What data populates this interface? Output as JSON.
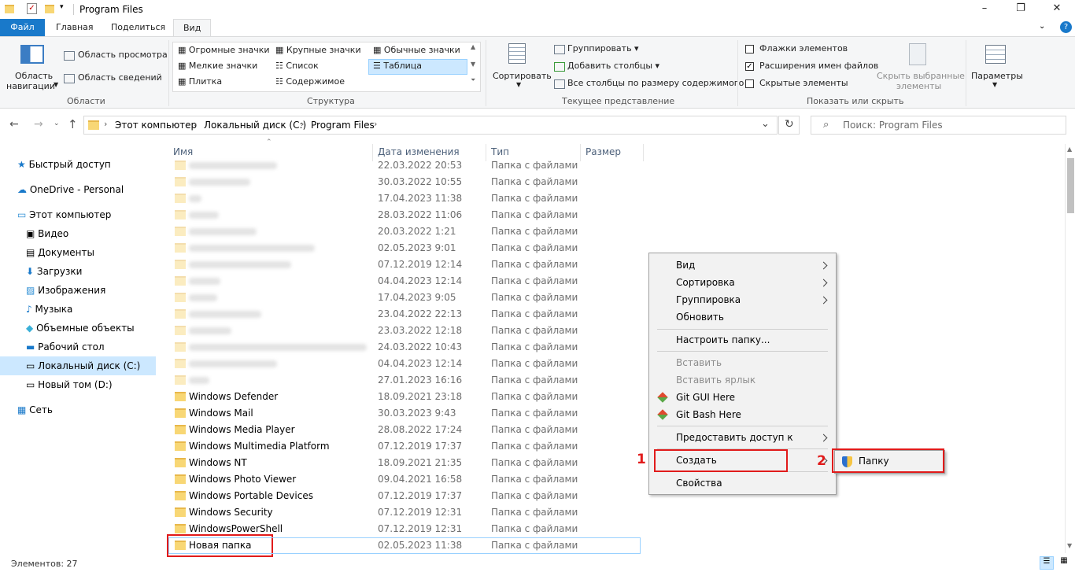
{
  "window": {
    "title": "Program Files"
  },
  "tabs": [
    "Файл",
    "Главная",
    "Поделиться",
    "Вид"
  ],
  "ribbon": {
    "panes": {
      "nav_label1": "Область",
      "nav_label2": "навигации",
      "preview": "Область просмотра",
      "details": "Область сведений",
      "title": "Области"
    },
    "layout": {
      "items": [
        "Огромные значки",
        "Крупные значки",
        "Обычные значки",
        "Мелкие значки",
        "Список",
        "Таблица",
        "Плитка",
        "Содержимое"
      ],
      "title": "Структура"
    },
    "current": {
      "sort": "Сортировать",
      "group": "Группировать",
      "add_cols": "Добавить столбцы",
      "fit_cols": "Все столбцы по размеру содержимого",
      "title": "Текущее представление"
    },
    "showhide": {
      "checkboxes": "Флажки элементов",
      "extensions": "Расширения имен файлов",
      "hidden": "Скрытые элементы",
      "hide_sel1": "Скрыть выбранные",
      "hide_sel2": "элементы",
      "title": "Показать или скрыть"
    },
    "options": "Параметры"
  },
  "address": {
    "crumbs": [
      "Этот компьютер",
      "Локальный диск (C:)",
      "Program Files"
    ],
    "search_placeholder": "Поиск: Program Files"
  },
  "nav": {
    "quick": "Быстрый доступ",
    "onedrive": "OneDrive - Personal",
    "pc": "Этот компьютер",
    "video": "Видео",
    "docs": "Документы",
    "downloads": "Загрузки",
    "images": "Изображения",
    "music": "Музыка",
    "objects3d": "Объемные объекты",
    "desktop": "Рабочий стол",
    "diskc": "Локальный диск (C:)",
    "diskd": "Новый том (D:)",
    "network": "Сеть"
  },
  "columns": {
    "name": "Имя",
    "date": "Дата изменения",
    "type": "Тип",
    "size": "Размер"
  },
  "rows": [
    {
      "date": "22.03.2022 20:53",
      "type": "Папка с файлами"
    },
    {
      "date": "30.03.2022 10:55",
      "type": "Папка с файлами"
    },
    {
      "date": "17.04.2023 11:38",
      "type": "Папка с файлами"
    },
    {
      "date": "28.03.2022 11:06",
      "type": "Папка с файлами"
    },
    {
      "date": "20.03.2022 1:21",
      "type": "Папка с файлами"
    },
    {
      "date": "02.05.2023 9:01",
      "type": "Папка с файлами"
    },
    {
      "date": "07.12.2019 12:14",
      "type": "Папка с файлами"
    },
    {
      "date": "04.04.2023 12:14",
      "type": "Папка с файлами"
    },
    {
      "date": "17.04.2023 9:05",
      "type": "Папка с файлами"
    },
    {
      "date": "23.04.2022 22:13",
      "type": "Папка с файлами"
    },
    {
      "date": "23.03.2022 12:18",
      "type": "Папка с файлами"
    },
    {
      "date": "24.03.2022 10:43",
      "type": "Папка с файлами"
    },
    {
      "date": "04.04.2023 12:14",
      "type": "Папка с файлами"
    },
    {
      "date": "27.01.2023 16:16",
      "type": "Папка с файлами"
    },
    {
      "name": "Windows Defender",
      "date": "18.09.2021 23:18",
      "type": "Папка с файлами"
    },
    {
      "name": "Windows Mail",
      "date": "30.03.2023 9:43",
      "type": "Папка с файлами"
    },
    {
      "name": "Windows Media Player",
      "date": "28.08.2022 17:24",
      "type": "Папка с файлами"
    },
    {
      "name": "Windows Multimedia Platform",
      "date": "07.12.2019 17:37",
      "type": "Папка с файлами"
    },
    {
      "name": "Windows NT",
      "date": "18.09.2021 21:35",
      "type": "Папка с файлами"
    },
    {
      "name": "Windows Photo Viewer",
      "date": "09.04.2021 16:58",
      "type": "Папка с файлами"
    },
    {
      "name": "Windows Portable Devices",
      "date": "07.12.2019 17:37",
      "type": "Папка с файлами"
    },
    {
      "name": "Windows Security",
      "date": "07.12.2019 12:31",
      "type": "Папка с файлами"
    },
    {
      "name": "WindowsPowerShell",
      "date": "07.12.2019 12:31",
      "type": "Папка с файлами"
    },
    {
      "name": "Новая папка",
      "date": "02.05.2023 11:38",
      "type": "Папка с файлами"
    }
  ],
  "context_menu": {
    "view": "Вид",
    "sort": "Сортировка",
    "group": "Группировка",
    "refresh": "Обновить",
    "customize": "Настроить папку...",
    "paste": "Вставить",
    "paste_link": "Вставить ярлык",
    "git_gui": "Git GUI Here",
    "git_bash": "Git Bash Here",
    "share": "Предоставить доступ к",
    "create": "Создать",
    "props": "Свойства"
  },
  "submenu": {
    "folder": "Папку"
  },
  "markers": {
    "one": "1",
    "two": "2"
  },
  "status": {
    "count": "Элементов: 27"
  },
  "colors": {
    "accent": "#1979ca",
    "highlight": "#e11b1b",
    "folder": "#f8d775"
  }
}
